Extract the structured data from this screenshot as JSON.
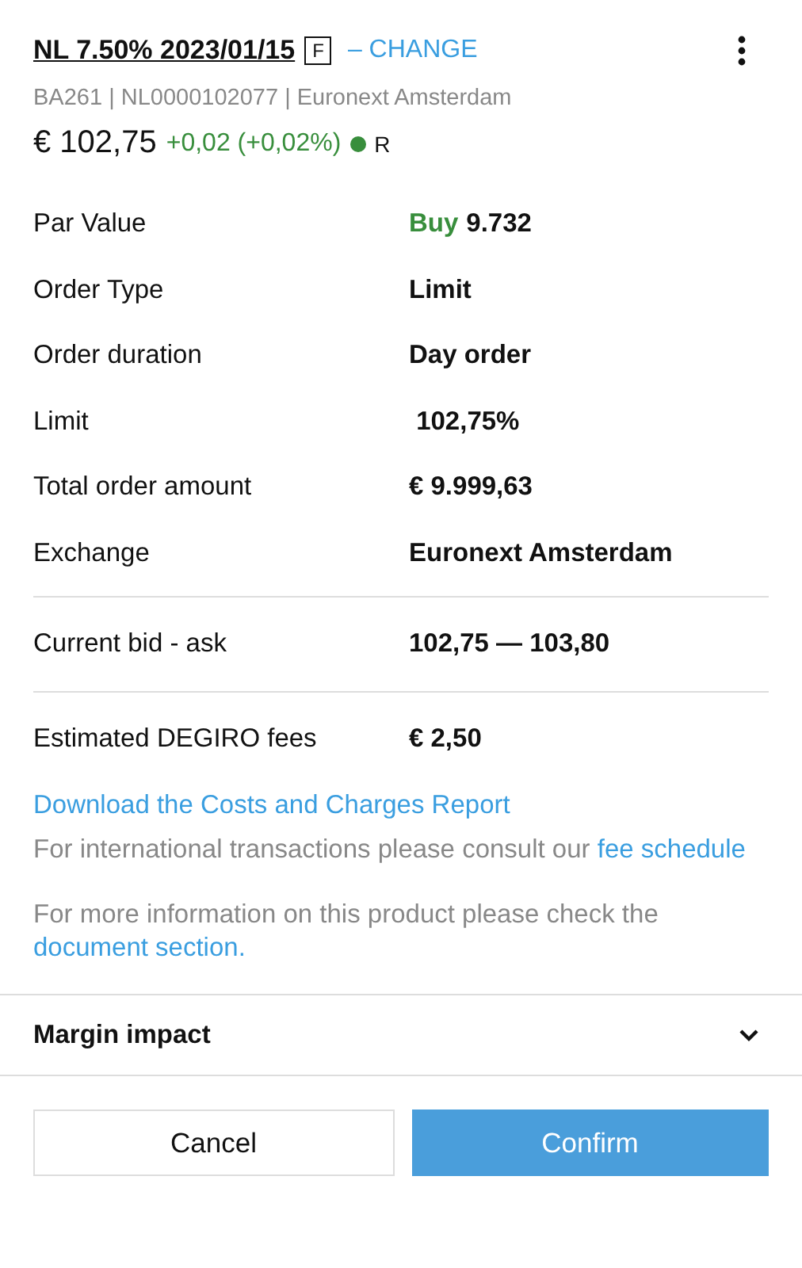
{
  "header": {
    "title": "NL 7.50% 2023/01/15",
    "type_badge": "F",
    "change_link": "– CHANGE",
    "subtitle": "BA261 | NL0000102077 | Euronext Amsterdam"
  },
  "quote": {
    "price": "€ 102,75",
    "change": "+0,02 (+0,02%)",
    "status": {
      "label": "R",
      "color": "#388e3c"
    }
  },
  "sections": [
    [
      {
        "label": "Par Value",
        "side": "Buy",
        "value": "9.732"
      },
      {
        "label": "Order Type",
        "value": "Limit"
      },
      {
        "label": "Order duration",
        "value": "Day order"
      },
      {
        "label": "Limit",
        "value": " 102,75%"
      },
      {
        "label": "Total order amount",
        "value": "€ 9.999,63"
      },
      {
        "label": "Exchange",
        "value": "Euronext Amsterdam"
      }
    ],
    [
      {
        "label": "Current bid - ask",
        "value": "102,75 — 103,80"
      }
    ],
    [
      {
        "label": "Estimated DEGIRO fees",
        "value": "€ 2,50"
      }
    ]
  ],
  "report_link": "Download the Costs and Charges Report",
  "notes": [
    {
      "text": "For international transactions please consult our ",
      "link": "fee schedule"
    },
    {
      "text": "For more information on this product please check the ",
      "link": "document section."
    }
  ],
  "margin": {
    "label": "Margin impact",
    "expanded": false
  },
  "buttons": [
    {
      "label": "Cancel",
      "kind": "secondary"
    },
    {
      "label": "Confirm",
      "kind": "primary"
    }
  ]
}
